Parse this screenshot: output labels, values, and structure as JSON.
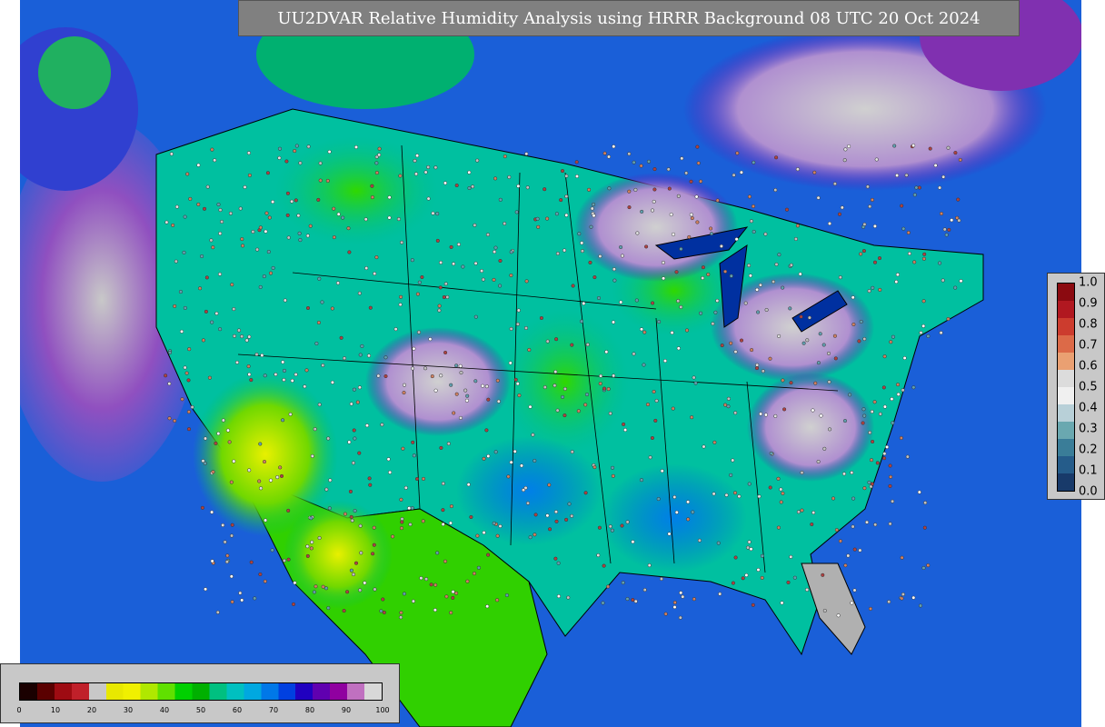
{
  "title": "UU2DVAR Relative Humidity Analysis using HRRR Background 08 UTC 20 Oct 2024",
  "rh_colorbar": {
    "ticks": [
      "0",
      "10",
      "20",
      "30",
      "40",
      "50",
      "60",
      "70",
      "80",
      "90",
      "100"
    ],
    "colors": [
      "#1a0000",
      "#5a0000",
      "#9e0b12",
      "#c0202a",
      "#c8c8c8",
      "#e8e800",
      "#f0f000",
      "#b0e800",
      "#60e000",
      "#00d000",
      "#00b000",
      "#00c080",
      "#00c0c0",
      "#00a8e0",
      "#0078e8",
      "#0040e0",
      "#2000c0",
      "#6000b0",
      "#9000a0",
      "#c070c0",
      "#d8d8d8"
    ]
  },
  "obs_colorbar": {
    "ticks": [
      "1.0",
      "0.9",
      "0.8",
      "0.7",
      "0.6",
      "0.5",
      "0.4",
      "0.3",
      "0.2",
      "0.1",
      "0.0"
    ],
    "colors": [
      "#8b0a10",
      "#b11820",
      "#cc3c2e",
      "#dc6a48",
      "#eaa072",
      "#dcdcdc",
      "#f0f0f0",
      "#b8d0d8",
      "#6aa8b0",
      "#3a7d98",
      "#255c8a",
      "#183a6a"
    ]
  },
  "map": {
    "land_color": "#00c0a0",
    "ocean_color": "#1a5fd8"
  }
}
